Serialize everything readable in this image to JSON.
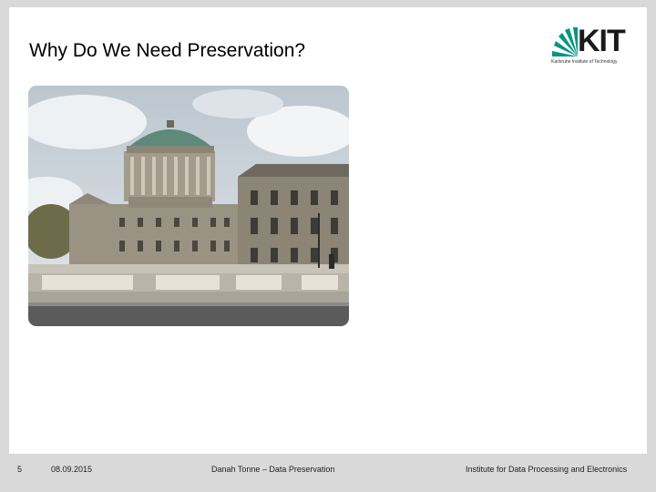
{
  "slide": {
    "title": "Why Do We Need Preservation?",
    "logo": {
      "text": "KIT",
      "subtitle": "Karlsruhe Institute of Technology",
      "icon": "kit-fan-logo-icon",
      "color": "#009682"
    },
    "photo": {
      "icon": "four-courts-dublin-photo"
    }
  },
  "footer": {
    "page_number": "5",
    "date": "08.09.2015",
    "presenter": "Danah Tonne – Data Preservation",
    "institute": "Institute for Data Processing and Electronics"
  },
  "colors": {
    "background": "#d9d9d9",
    "slide": "#ffffff",
    "kit_green": "#009682"
  }
}
